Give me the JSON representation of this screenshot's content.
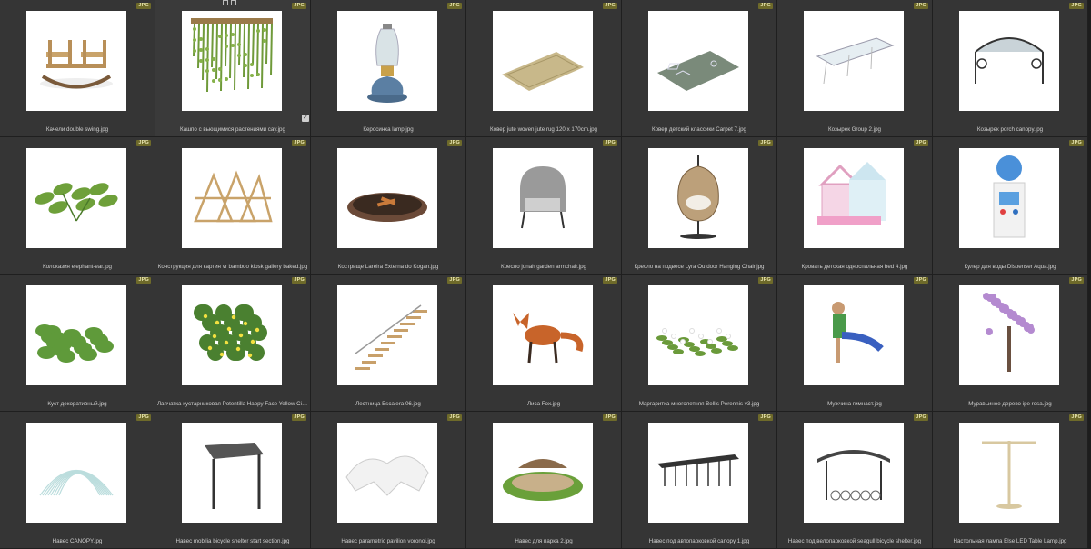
{
  "badge_text": "JPG",
  "items": [
    {
      "name": "Качели double swing.jpg",
      "icon": "double-swing"
    },
    {
      "name": "Кашпо с вьющимися растениями cay.jpg",
      "icon": "hanging-plants",
      "selected": true
    },
    {
      "name": "Керосинка lamp.jpg",
      "icon": "kerosene-lamp"
    },
    {
      "name": "Ковер jute woven jute rug 120 x 170cm.jpg",
      "icon": "jute-rug"
    },
    {
      "name": "Ковер детский классики Carpet 7.jpg",
      "icon": "kids-carpet"
    },
    {
      "name": "Козырек Group 2.jpg",
      "icon": "glass-canopy"
    },
    {
      "name": "Козырек porch canopy.jpg",
      "icon": "porch-canopy"
    },
    {
      "name": "Колоказия elephant-ear.jpg",
      "icon": "elephant-ear-plant"
    },
    {
      "name": "Конструкция для картин vr bamboo kiosk gallery baked.jpg",
      "icon": "bamboo-kiosk"
    },
    {
      "name": "Кострище Lareira Externa do Kogan.jpg",
      "icon": "fire-pit"
    },
    {
      "name": "Кресло jonah garden armchair.jpg",
      "icon": "armchair"
    },
    {
      "name": "Кресло на подвесе Lyra Outdoor Hanging Chair.jpg",
      "icon": "hanging-chair"
    },
    {
      "name": "Кровать детская односпальная bed 4.jpg",
      "icon": "kids-bed"
    },
    {
      "name": "Кулер для воды Dispenser Aqua.jpg",
      "icon": "water-cooler"
    },
    {
      "name": "Куст декоративный.jpg",
      "icon": "decorative-bush"
    },
    {
      "name": "Лапчатка кустарниковая Potentilla Happy Face Yellow Cin...",
      "icon": "potentilla-shrub"
    },
    {
      "name": "Лестница Escalera 06.jpg",
      "icon": "staircase"
    },
    {
      "name": "Лиса Fox.jpg",
      "icon": "fox"
    },
    {
      "name": "Маргаритка многолетняя Bellis Perennis v3.jpg",
      "icon": "daisy-flowers"
    },
    {
      "name": "Мужчина гимнаст.jpg",
      "icon": "gymnast-man"
    },
    {
      "name": "Муравьиное дерево ipe rosa.jpg",
      "icon": "ipe-rosa-tree"
    },
    {
      "name": "Навес CANOPY.jpg",
      "icon": "canopy-tunnel"
    },
    {
      "name": "Навес mobilia bicycle shelter start section.jpg",
      "icon": "bicycle-shelter"
    },
    {
      "name": "Навес parametric pavilion voronoi.jpg",
      "icon": "parametric-pavilion"
    },
    {
      "name": "Навес для парка 2.jpg",
      "icon": "park-pavilion"
    },
    {
      "name": "Навес под автопарковкой canopy 1.jpg",
      "icon": "carport-canopy"
    },
    {
      "name": "Навес под велопарковкой seagull bicycle shelter.jpg",
      "icon": "seagull-shelter"
    },
    {
      "name": "Настольная лампа Else LED Table Lamp.jpg",
      "icon": "table-lamp"
    }
  ]
}
